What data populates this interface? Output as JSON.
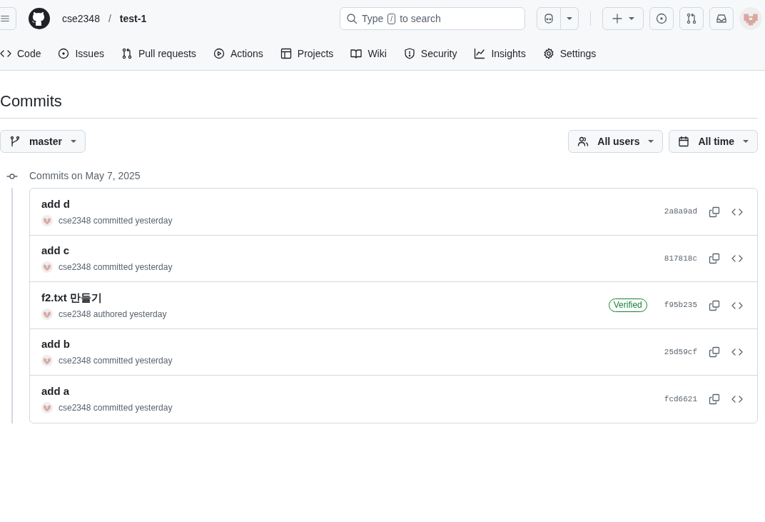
{
  "header": {
    "owner": "cse2348",
    "separator": "/",
    "repo": "test-1",
    "search": {
      "placeholder_parts": [
        "Type",
        "/",
        "to search"
      ]
    }
  },
  "tabs": [
    {
      "label": "Code"
    },
    {
      "label": "Issues"
    },
    {
      "label": "Pull requests"
    },
    {
      "label": "Actions"
    },
    {
      "label": "Projects"
    },
    {
      "label": "Wiki"
    },
    {
      "label": "Security"
    },
    {
      "label": "Insights"
    },
    {
      "label": "Settings"
    }
  ],
  "page_title": "Commits",
  "filters": {
    "branch": "master",
    "users": "All users",
    "time": "All time"
  },
  "group": {
    "heading": "Commits on May 7, 2025",
    "commits": [
      {
        "title": "add d",
        "byline": "cse2348 committed yesterday",
        "sha": "2a8a9ad"
      },
      {
        "title": "add c",
        "byline": "cse2348 committed yesterday",
        "sha": "817818c"
      },
      {
        "title": "f2.txt 만들기",
        "byline": "cse2348 authored yesterday",
        "sha": "f95b235",
        "badge": "Verified"
      },
      {
        "title": "add b",
        "byline": "cse2348 committed yesterday",
        "sha": "25d59cf"
      },
      {
        "title": "add a",
        "byline": "cse2348 committed yesterday",
        "sha": "fcd6621"
      }
    ]
  }
}
